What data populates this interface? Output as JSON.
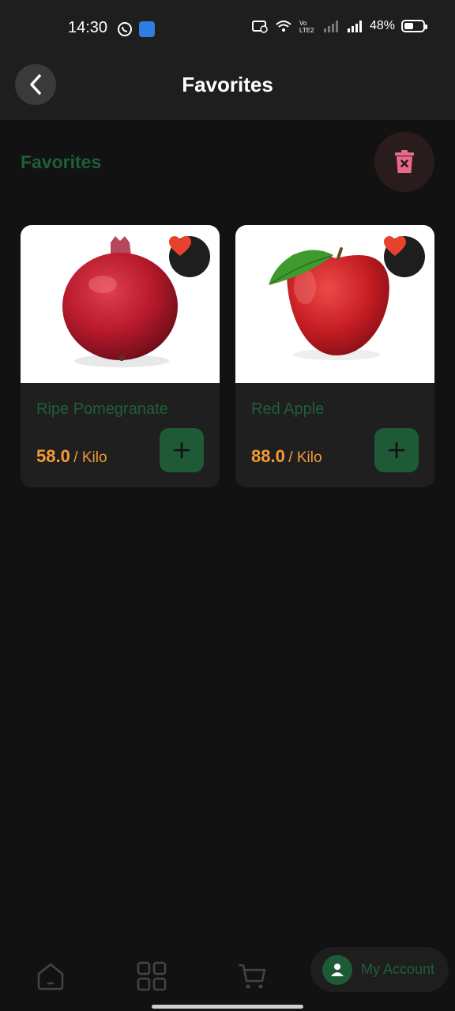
{
  "status_bar": {
    "time": "14:30",
    "battery_percent": "48%",
    "battery_level": 0.48,
    "icons": [
      "whatsapp-icon",
      "android-app-icon",
      "cast-icon",
      "wifi-icon",
      "volte-icon",
      "signal-icon",
      "battery-icon"
    ]
  },
  "header": {
    "title": "Favorites",
    "back_icon": "chevron-left-icon"
  },
  "section": {
    "title": "Favorites",
    "delete_icon": "trash-icon"
  },
  "products": [
    {
      "name": "Ripe Pomegranate",
      "price": "58.0",
      "unit": "/ Kilo",
      "favorite": true,
      "image": "pomegranate"
    },
    {
      "name": "Red Apple",
      "price": "88.0",
      "unit": "/ Kilo",
      "favorite": true,
      "image": "red-apple"
    }
  ],
  "bottom_nav": {
    "items": [
      "home-icon",
      "categories-icon",
      "cart-icon"
    ],
    "account_label": "My Account"
  },
  "colors": {
    "background": "#121212",
    "surface": "#1f1f1f",
    "accent_green": "#1f5a37",
    "price_orange": "#f39c33",
    "heart_red": "#e8412c",
    "delete_pink": "#e96a8a"
  }
}
